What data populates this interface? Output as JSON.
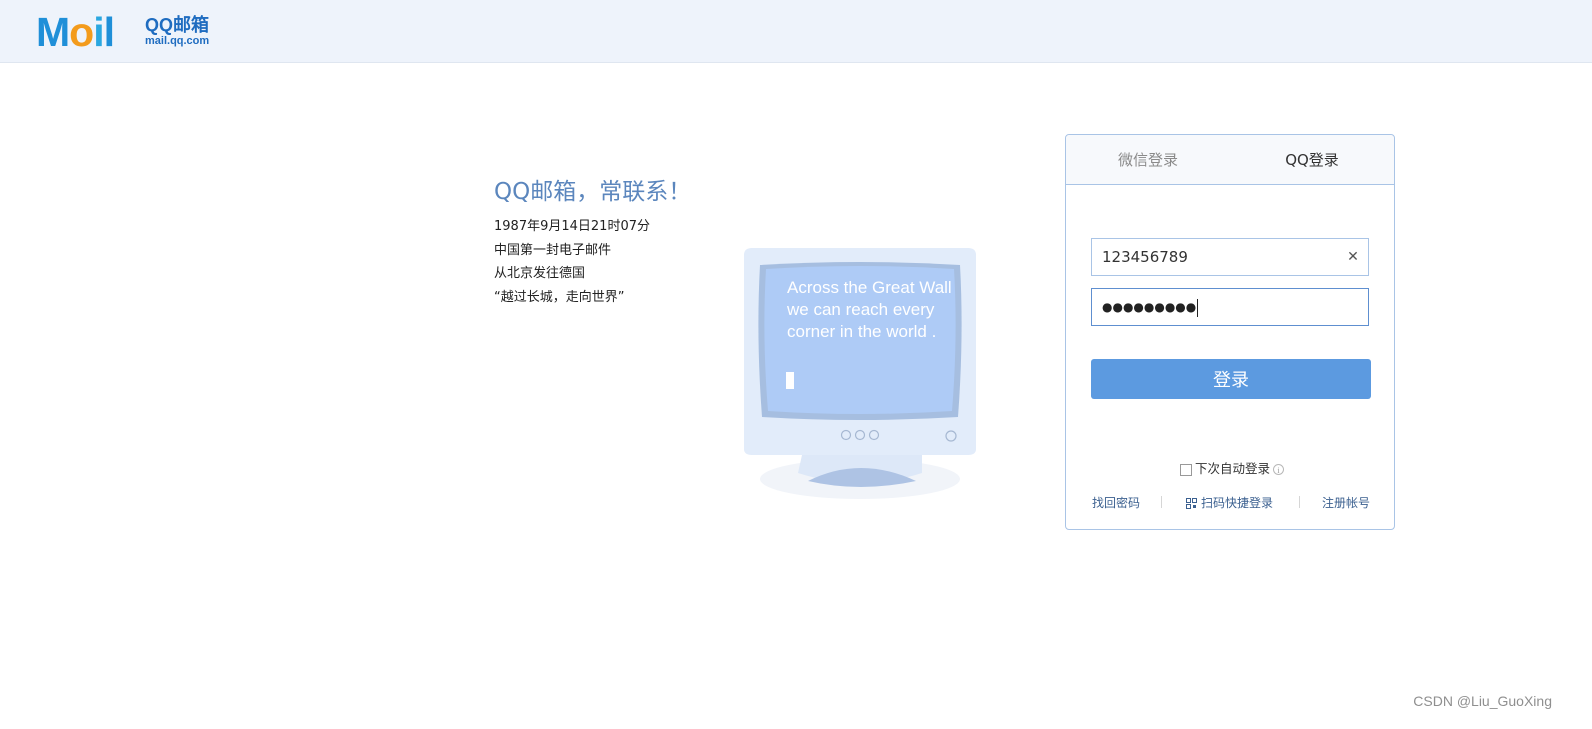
{
  "header": {
    "logo_mail_letters": [
      "M",
      "o",
      "i",
      "l"
    ],
    "logo_cn": "QQ邮箱",
    "logo_url": "mail.qq.com"
  },
  "slogan": {
    "title": "QQ邮箱，常联系！",
    "lines": [
      "1987年9月14日21时07分",
      "中国第一封电子邮件",
      "从北京发往德国",
      "“越过长城，走向世界”"
    ]
  },
  "monitor": {
    "screen_text": "Across the Great Wall we can reach every corner in the world ."
  },
  "login": {
    "tabs": [
      {
        "label": "微信登录",
        "active": false
      },
      {
        "label": "QQ登录",
        "active": true
      }
    ],
    "account_value": "123456789",
    "clear_icon": "close-icon",
    "password_mask": "●●●●●●●●●",
    "submit_label": "登录",
    "auto_login_label": "下次自动登录",
    "info_icon": "info-icon",
    "links": {
      "find_password": "找回密码",
      "scan_login": "扫码快捷登录",
      "register": "注册帐号"
    },
    "qr_icon": "qr-code-icon"
  },
  "watermark": "CSDN @Liu_GuoXing",
  "colors": {
    "header_bg": "#eef3fb",
    "accent": "#5c9ae0",
    "slogan_title": "#5b86bd",
    "panel_border": "#a9c4e6",
    "link": "#3a5f8f"
  }
}
